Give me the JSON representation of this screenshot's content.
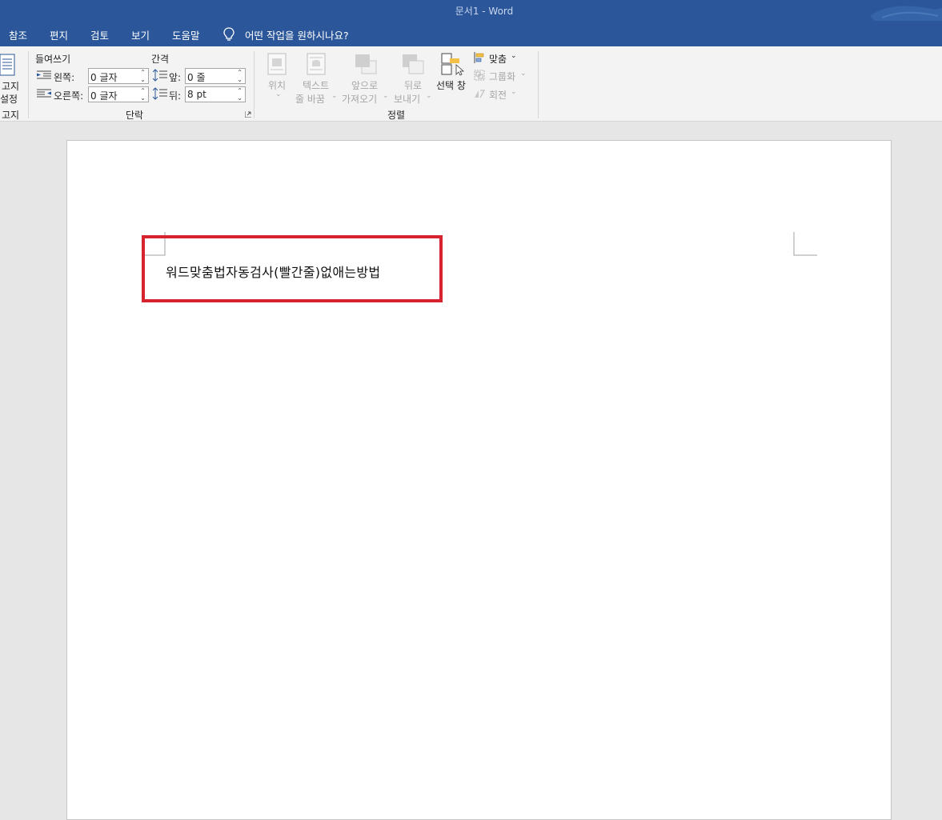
{
  "window": {
    "title": "문서1  -  Word"
  },
  "menu": {
    "items": [
      "참조",
      "편지",
      "검토",
      "보기",
      "도움말"
    ],
    "tell_me": "어떤 작업을 원하시나요?"
  },
  "ribbon": {
    "cut_group": {
      "label_line1": "고지",
      "label_line2": "설정",
      "group_label": "고지"
    },
    "paragraph": {
      "indent_label": "들여쓰기",
      "spacing_label": "간격",
      "left_label": "왼쪽:",
      "right_label": "오른쪽:",
      "before_label": "앞:",
      "after_label": "뒤:",
      "left_value": "0 글자",
      "right_value": "0 글자",
      "before_value": "0 줄",
      "after_value": "8 pt",
      "group_label": "단락"
    },
    "arrange": {
      "position_line1": "위치",
      "wrap_line1": "텍스트",
      "wrap_line2": "줄 바꿈",
      "forward_line1": "앞으로",
      "forward_line2": "가져오기",
      "backward_line1": "뒤로",
      "backward_line2": "보내기",
      "selection_pane": "선택 창",
      "align": "맞춤",
      "group": "그룹화",
      "rotate": "회전",
      "group_label": "정렬"
    }
  },
  "document": {
    "text": "워드맞춤법자동검사(빨간줄)없애는방법"
  },
  "colors": {
    "title_bar": "#2b579a",
    "highlight_box": "#d7232f"
  }
}
